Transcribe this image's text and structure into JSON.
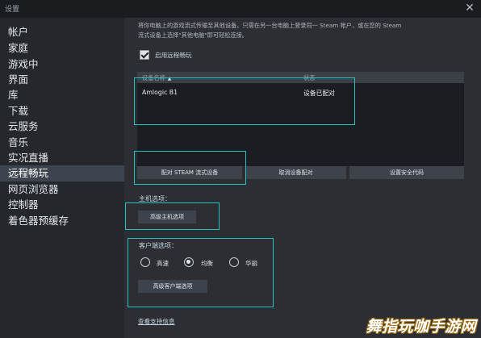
{
  "window": {
    "title": "设置",
    "close_glyph": "✕"
  },
  "sidebar": {
    "items": [
      {
        "label": "帐户"
      },
      {
        "label": "家庭"
      },
      {
        "label": "游戏中"
      },
      {
        "label": "界面"
      },
      {
        "label": "库"
      },
      {
        "label": "下载"
      },
      {
        "label": "云服务"
      },
      {
        "label": "音乐"
      },
      {
        "label": "实况直播"
      },
      {
        "label": "远程畅玩",
        "active": true
      },
      {
        "label": "网页浏览器"
      },
      {
        "label": "控制器"
      },
      {
        "label": "着色器预缓存"
      }
    ]
  },
  "main": {
    "description_line1": "将你电脑上的游戏流式传输至其他设备。只需在另一台电脑上登录同一 Steam 帐户，或在您的 Steam",
    "description_line2": "流式设备上选择\"其他电脑\"即可轻松连接。",
    "enable_checkbox": {
      "label": "启用远程畅玩",
      "checked": true
    },
    "device_table": {
      "columns": [
        "设备名称",
        "状态"
      ],
      "sort_indicator": "▲",
      "rows": [
        {
          "name": "Amlogic B1",
          "status": "设备已配对"
        }
      ]
    },
    "buttons": {
      "pair": "配对 STEAM 流式设备",
      "unpair": "取消设备配对",
      "security_code": "设置安全代码"
    },
    "host_options": {
      "label": "主机选项：",
      "button": "高级主机选项"
    },
    "client_options": {
      "label": "客户端选项：",
      "radios": [
        {
          "label": "高速",
          "checked": false
        },
        {
          "label": "均衡",
          "checked": true
        },
        {
          "label": "华丽",
          "checked": false
        }
      ],
      "button": "高级客户端选项"
    },
    "support_link": "查看支持信息"
  },
  "watermark": "舞指玩咖手游网",
  "colors": {
    "highlight_box": "#21c2c2",
    "active_nav": "#3d4450",
    "window_bg": "#2c2e33"
  }
}
